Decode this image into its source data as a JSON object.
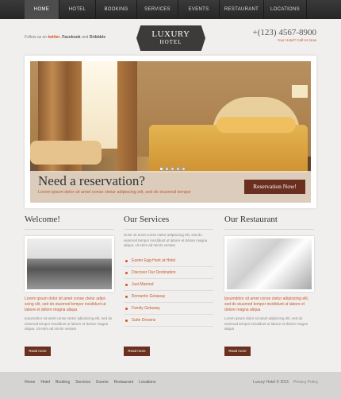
{
  "nav": {
    "items": [
      {
        "label": "HOME",
        "active": true
      },
      {
        "label": "Hotel",
        "active": false
      },
      {
        "label": "Booking",
        "active": false
      },
      {
        "label": "Services",
        "active": false
      },
      {
        "label": "Events",
        "active": false
      },
      {
        "label": "Restaurant",
        "active": false
      },
      {
        "label": "Locations",
        "active": false
      }
    ]
  },
  "header": {
    "follow_prefix": "Follow us on",
    "follow_twitter": "twitter",
    "follow_sep": ",",
    "follow_facebook": "Facebook",
    "follow_and": "and",
    "follow_dribbble": "Dribbble",
    "logo_line1": "LUXURY",
    "logo_line2": "HOTEL",
    "phone": "+(123) 4567-8900",
    "phone_sub": "Your Hotel? Call Us Now"
  },
  "hero": {
    "title": "Need a reservation?",
    "text": "Lorem ipsum dolor sit amet conse ctetur adipiscing elit, sed do eiusmod tempor",
    "button": "Reservation Now!"
  },
  "welcome": {
    "title": "Welcome!",
    "orange_text": "Lorem ipsum dolor sit amet conse ctetur adipi-scing elit, sed do eiusmod tempor incididunt ut labore et dolore magna aliqua",
    "text": "Ipsumdolor sit amet conse ctetur adipisicing elit, sed do eiusmod tempor incididunt ut labore et dolore magna aliqua. Ut enim ad minim veniam",
    "readmore": "Read more"
  },
  "services": {
    "title": "Our Services",
    "intro": "Dolor sit amet conse ctetur adipisicing elit, sed do eiusmod tempor incididunt ut labore et dolore magna aliqua. Ut enim ad minim veniam",
    "items": [
      "Easter Egg Hunt at Hotel",
      "Discover Our Destination",
      "Just Married",
      "Romantic Getaway",
      "Family Getaway",
      "Suite Dreams"
    ],
    "readmore": "Read more"
  },
  "restaurant": {
    "title": "Our Restaurant",
    "orange_text": "Ipsumdolor sit amet conse ctetur adipisicing elit, sed do eiusmod tempor incididunt ut labore et dolore magna aliqua",
    "text": "Lorem ipsum dolor sit amet adipiscing elit, sed do eiusmod tempor incididunt ut labore et dolore magna aliqua",
    "readmore": "Read more"
  },
  "footer": {
    "links": [
      "Home",
      "Hotel",
      "Booking",
      "Services",
      "Events",
      "Restaurant",
      "Locations"
    ],
    "copyright": "Luxury Hotel © 2011",
    "privacy": "Privacy Policy"
  },
  "colors": {
    "accent": "#c65a26",
    "button": "#6b2f1f",
    "nav": "#2e2e2e"
  }
}
